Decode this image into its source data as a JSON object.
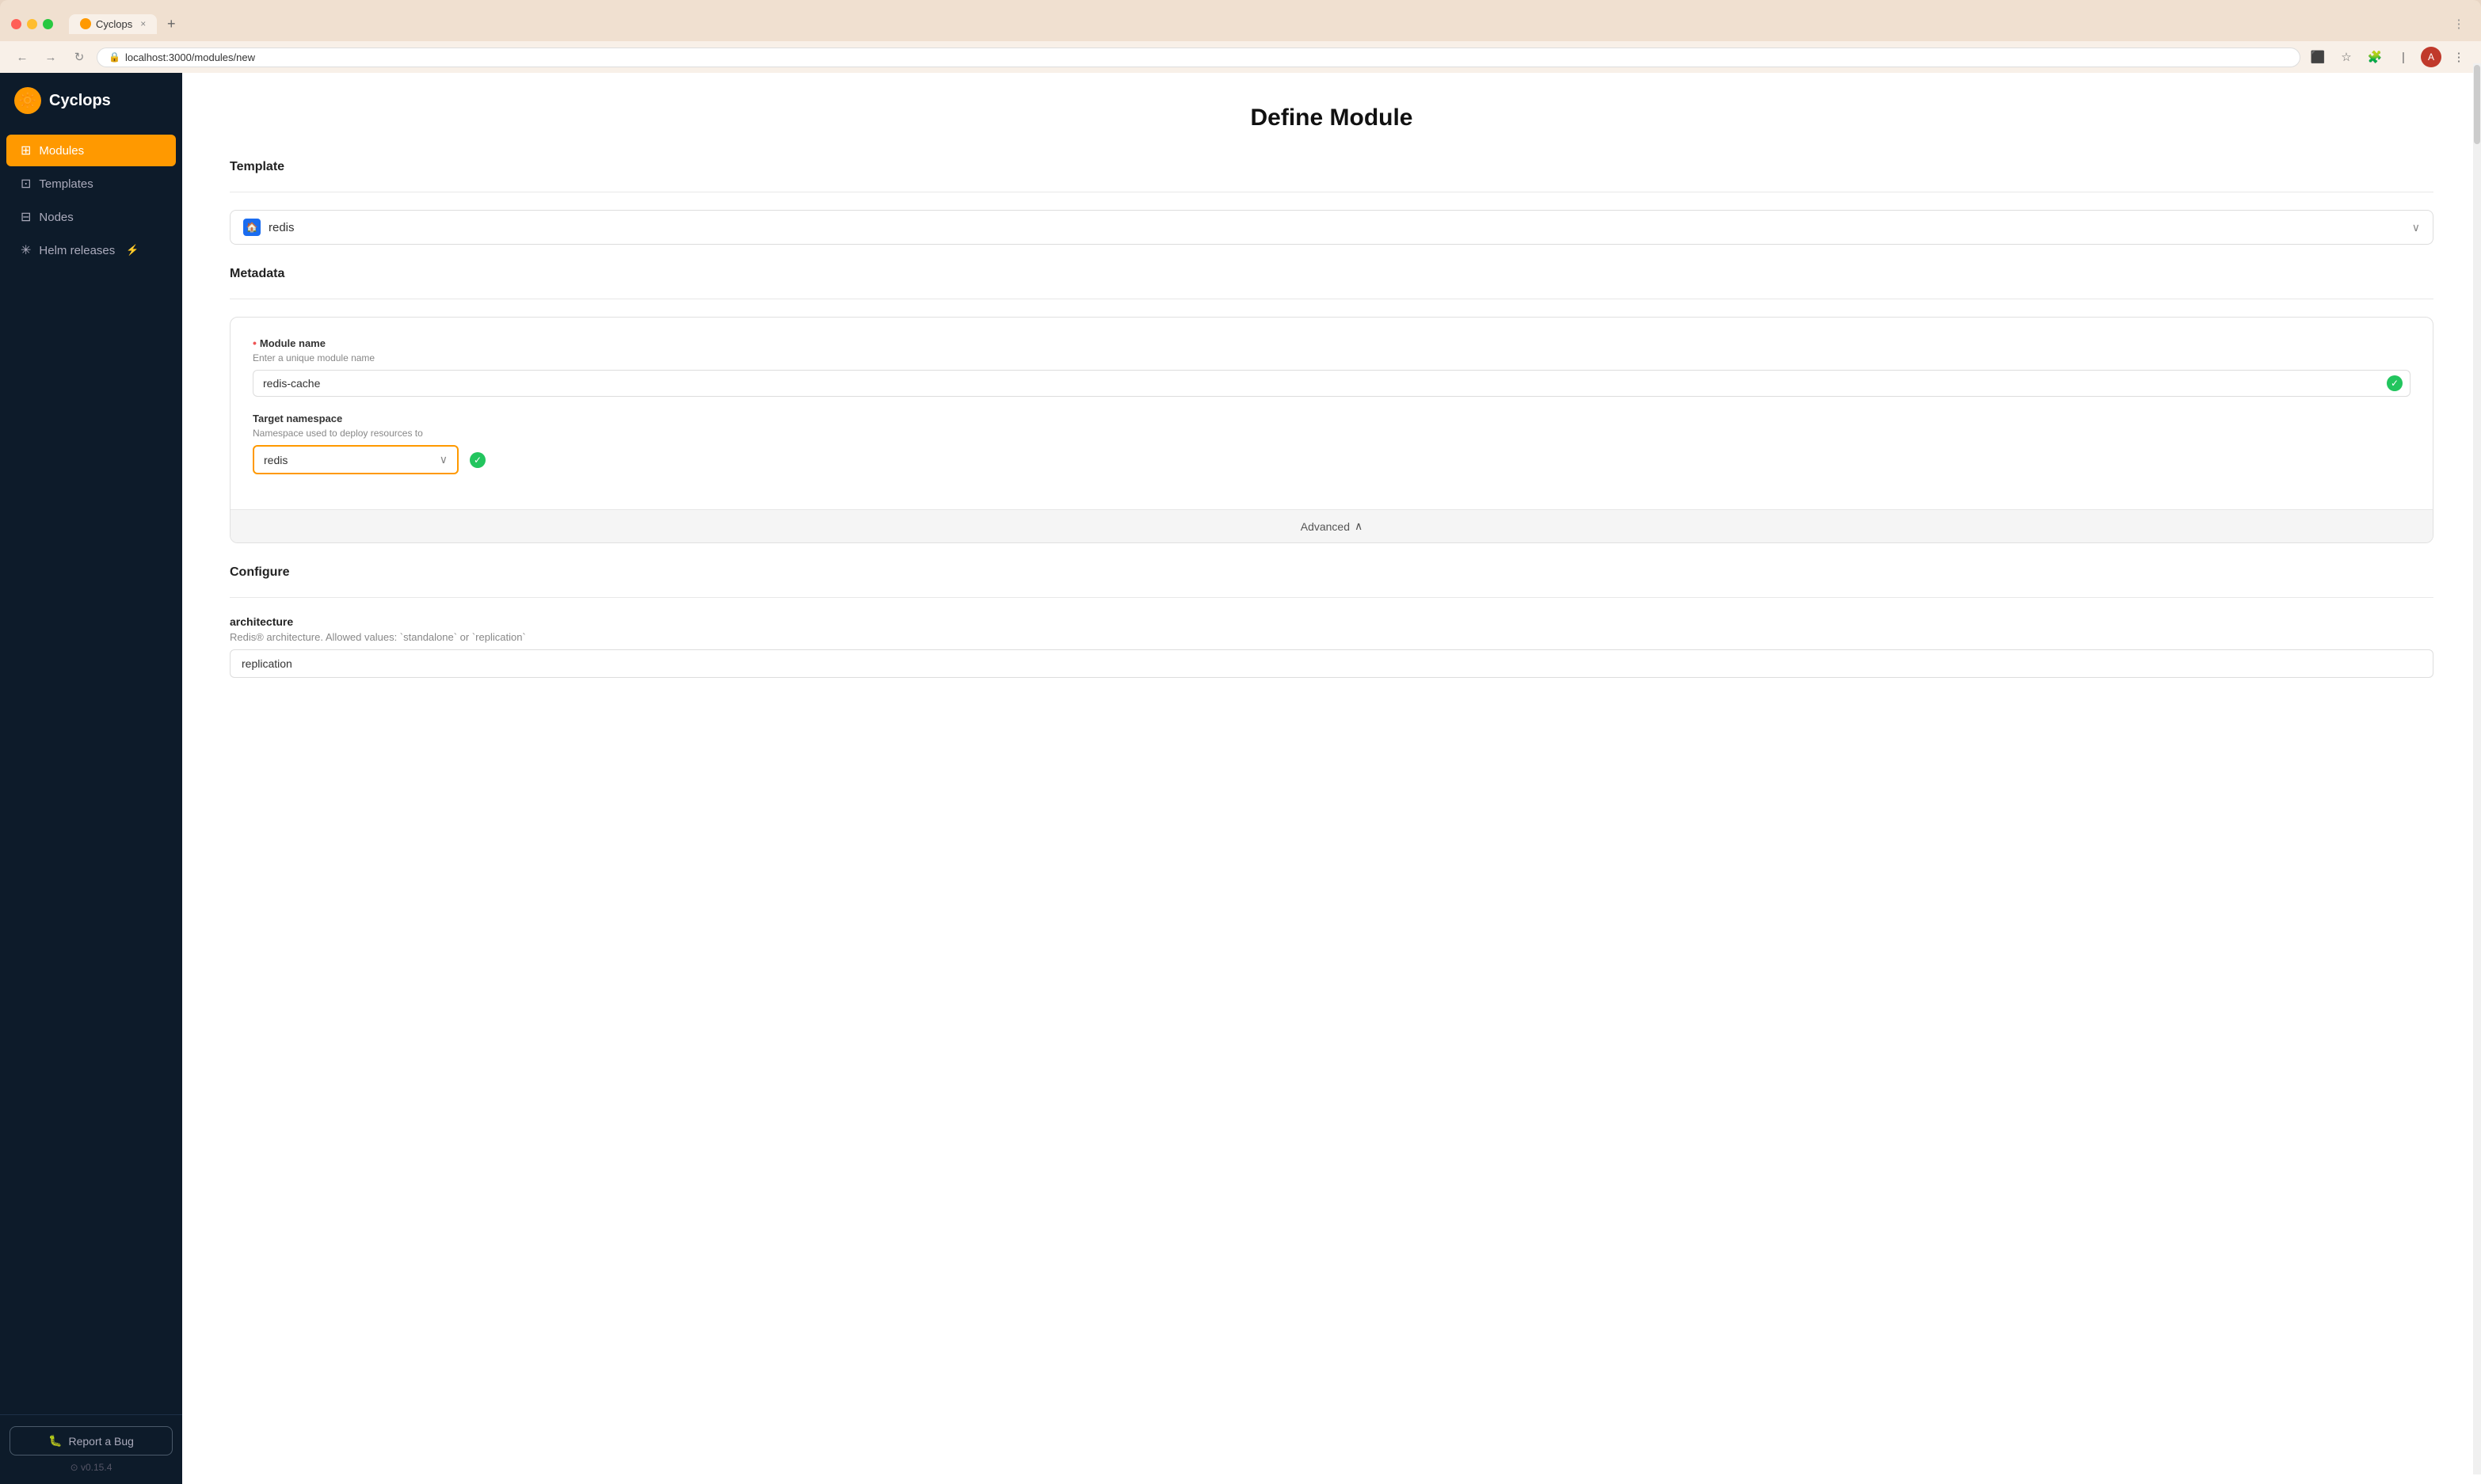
{
  "browser": {
    "url": "localhost:3000/modules/new",
    "tab_title": "Cyclops",
    "tab_close": "×",
    "tab_new": "+"
  },
  "sidebar": {
    "logo_text": "Cyclops",
    "nav_items": [
      {
        "id": "modules",
        "label": "Modules",
        "icon": "⊞",
        "active": true
      },
      {
        "id": "templates",
        "label": "Templates",
        "icon": "⊡",
        "active": false
      },
      {
        "id": "nodes",
        "label": "Nodes",
        "icon": "⊟",
        "active": false
      },
      {
        "id": "helm-releases",
        "label": "Helm releases",
        "icon": "✳",
        "active": false,
        "badge": "⚡"
      }
    ],
    "report_bug_label": "Report a Bug",
    "report_bug_icon": "🐛",
    "version": "v0.15.4"
  },
  "main": {
    "page_title": "Define Module",
    "template_section_label": "Template",
    "template_selected": "redis",
    "metadata_section_label": "Metadata",
    "module_name_label": "Module name",
    "module_name_required": true,
    "module_name_hint": "Enter a unique module name",
    "module_name_value": "redis-cache",
    "target_namespace_label": "Target namespace",
    "target_namespace_hint": "Namespace used to deploy resources to",
    "target_namespace_value": "redis",
    "advanced_label": "Advanced",
    "configure_section_label": "Configure",
    "architecture_label": "architecture",
    "architecture_hint": "Redis® architecture. Allowed values: `standalone` or `replication`",
    "architecture_value": "replication"
  }
}
